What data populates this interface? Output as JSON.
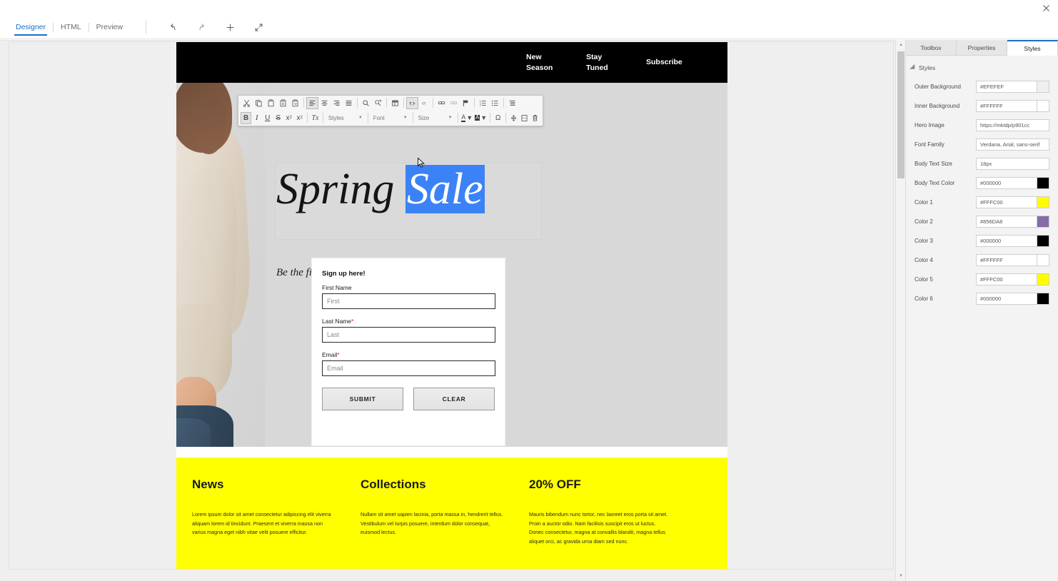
{
  "window": {
    "close_label": "×"
  },
  "apptoolbar": {
    "tabs": [
      {
        "label": "Designer",
        "active": true
      },
      {
        "label": "HTML",
        "active": false
      },
      {
        "label": "Preview",
        "active": false
      }
    ],
    "actions": [
      {
        "name": "undo",
        "icon": "undo-icon"
      },
      {
        "name": "redo",
        "icon": "redo-icon"
      },
      {
        "name": "add",
        "icon": "plus-icon"
      },
      {
        "name": "fullscreen",
        "icon": "expand-icon"
      }
    ]
  },
  "rte": {
    "row1": [
      {
        "icon": "cut-icon",
        "title": "Cut"
      },
      {
        "icon": "copy-icon",
        "title": "Copy"
      },
      {
        "icon": "paste-icon",
        "title": "Paste"
      },
      {
        "icon": "paste-text-icon",
        "title": "Paste as plain text"
      },
      {
        "icon": "paste-word-icon",
        "title": "Paste from Word"
      },
      {
        "icon": "align-left-icon",
        "title": "Align Left",
        "active": true
      },
      {
        "icon": "align-center-icon",
        "title": "Center"
      },
      {
        "icon": "align-right-icon",
        "title": "Align Right"
      },
      {
        "icon": "align-justify-icon",
        "title": "Justify"
      },
      {
        "icon": "find-icon",
        "title": "Find"
      },
      {
        "icon": "replace-icon",
        "title": "Replace"
      },
      {
        "icon": "table-icon",
        "title": "Table"
      },
      {
        "icon": "ltr-icon",
        "title": "Left to Right",
        "active": true
      },
      {
        "icon": "rtl-icon",
        "title": "Right to Left"
      },
      {
        "icon": "link-icon",
        "title": "Link"
      },
      {
        "icon": "unlink-icon",
        "title": "Unlink"
      },
      {
        "icon": "anchor-flag-icon",
        "title": "Anchor"
      },
      {
        "icon": "numbered-list-icon",
        "title": "Numbered List"
      },
      {
        "icon": "bulleted-list-icon",
        "title": "Bulleted List"
      },
      {
        "icon": "blockquote-icon",
        "title": "Block Quote"
      }
    ],
    "row2": {
      "bold": {
        "label": "B",
        "icon": "bold-icon",
        "active": true
      },
      "italic": {
        "label": "I",
        "icon": "italic-icon"
      },
      "underline": {
        "label": "U",
        "icon": "underline-icon"
      },
      "strike": {
        "label": "S",
        "icon": "strikethrough-icon"
      },
      "subscript": {
        "label": "x",
        "sub": "2",
        "icon": "subscript-icon"
      },
      "superscript": {
        "label": "x",
        "sup": "2",
        "icon": "superscript-icon"
      },
      "removeformat": {
        "label": "Tx",
        "icon": "remove-format-icon"
      },
      "styles_select": {
        "label": "Styles"
      },
      "font_select": {
        "label": "Font"
      },
      "size_select": {
        "label": "Size"
      },
      "textcolor": {
        "label": "A",
        "icon": "text-color-icon"
      },
      "bgcolor": {
        "label": "A",
        "icon": "background-color-icon"
      },
      "omega": {
        "label": "Ω",
        "icon": "special-character-icon"
      },
      "anchor": {
        "icon": "anchor-icon"
      },
      "pagebreak": {
        "icon": "page-break-icon"
      },
      "delete": {
        "icon": "trash-icon"
      }
    }
  },
  "email": {
    "nav": [
      {
        "line1": "New",
        "line2": "Season"
      },
      {
        "line1": "Stay",
        "line2": "Tuned"
      },
      {
        "line1": "Subscribe",
        "line2": ""
      }
    ],
    "headline_part1": "Spring ",
    "headline_selected": "Sale",
    "subheadline": "Be the first to receive our discounts",
    "signup": {
      "title": "Sign up here!",
      "fields": [
        {
          "label": "First Name",
          "required": false,
          "placeholder": "First",
          "value": ""
        },
        {
          "label": "Last Name",
          "required": true,
          "placeholder": "Last",
          "value": ""
        },
        {
          "label": "Email",
          "required": true,
          "placeholder": "Email",
          "value": ""
        }
      ],
      "submit_label": "SUBMIT",
      "clear_label": "CLEAR"
    },
    "footer_columns": [
      {
        "heading": "News",
        "body": "Lorem ipsum dolor sit amet consectetur adipiscing elit viverra aliquam lorem id tincidunt. Praesent et viverra massa non varius magna eget nibh vitae velit posuere efficitur."
      },
      {
        "heading": "Collections",
        "body": "Nullam sit amet sapien lacinia, porta massa in, hendrerit tellus. Vestibulum vel turpis posuere, interdum dolor consequat, euismod lectus."
      },
      {
        "heading": "20% OFF",
        "body": "Mauris bibendum nunc tortor, nec laoreet eros porta sit amet. Proin a auctor odio. Nam facilisis suscipit eros ut luctus. Donec consectetur, magna at convallis blandit, magna tellus aliquet orci, ac gravida urna diam sed nunc."
      }
    ]
  },
  "right_panel": {
    "tabs": [
      {
        "label": "Toolbox",
        "active": false
      },
      {
        "label": "Properties",
        "active": false
      },
      {
        "label": "Styles",
        "active": true
      }
    ],
    "section_title": "Styles",
    "properties": [
      {
        "label": "Outer Background",
        "value": "#EFEFEF",
        "swatch": "#EFEFEF",
        "has_swatch": true
      },
      {
        "label": "Inner Background",
        "value": "#FFFFFF",
        "swatch": "#FFFFFF",
        "has_swatch": true
      },
      {
        "label": "Hero Image",
        "value": "https://mktdp/p901cc",
        "has_swatch": false
      },
      {
        "label": "Font Family",
        "value": "Verdana, Arial, sans-serif",
        "has_swatch": false
      },
      {
        "label": "Body Text Size",
        "value": "18px",
        "has_swatch": false
      },
      {
        "label": "Body Text Color",
        "value": "#000000",
        "swatch": "#000000",
        "has_swatch": true
      },
      {
        "label": "Color 1",
        "value": "#FFFC00",
        "swatch": "#FFFC00",
        "has_swatch": true
      },
      {
        "label": "Color 2",
        "value": "#856DA8",
        "swatch": "#856DA8",
        "has_swatch": true
      },
      {
        "label": "Color 3",
        "value": "#000000",
        "swatch": "#000000",
        "has_swatch": true
      },
      {
        "label": "Color 4",
        "value": "#FFFFFF",
        "swatch": "#FFFFFF",
        "has_swatch": true
      },
      {
        "label": "Color 5",
        "value": "#FFFC00",
        "swatch": "#FFFC00",
        "has_swatch": true
      },
      {
        "label": "Color 6",
        "value": "#000000",
        "swatch": "#000000",
        "has_swatch": true
      }
    ]
  },
  "scrollbar": {
    "up": "▲",
    "down": "▼"
  }
}
